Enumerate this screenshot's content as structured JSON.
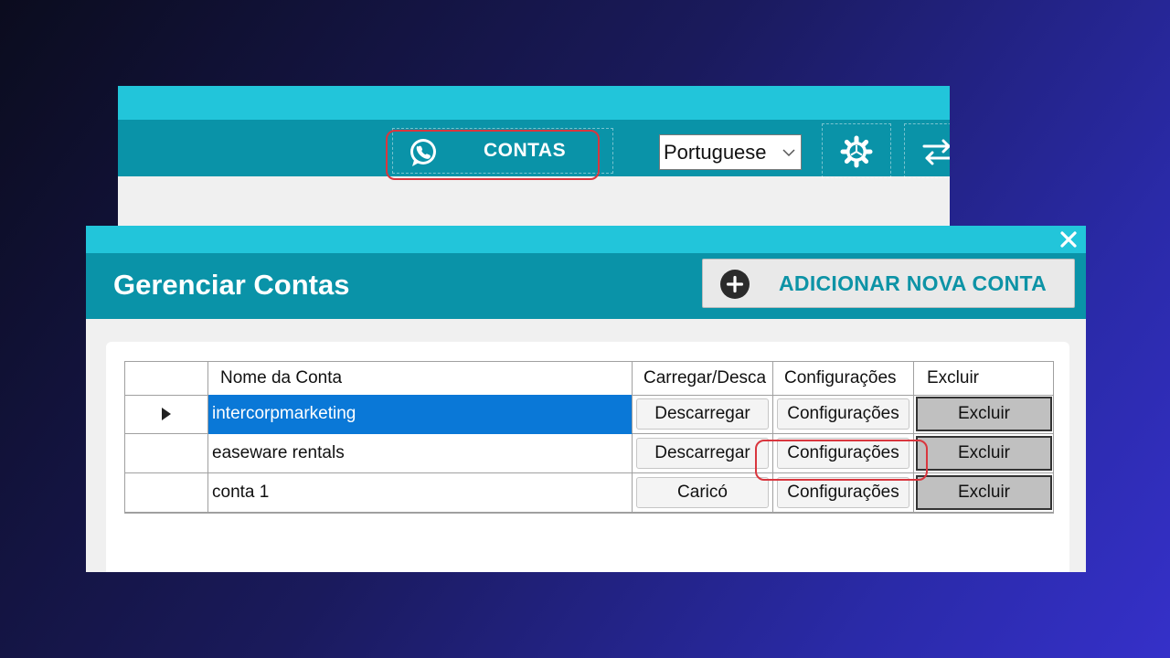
{
  "back_window": {
    "contas_label": "CONTAS",
    "language": {
      "selected": "Portuguese"
    }
  },
  "dialog": {
    "title": "Gerenciar Contas",
    "add_button_label": "ADICIONAR NOVA CONTA",
    "grid": {
      "columns": [
        "",
        "Nome da Conta",
        "Carregar/Desca",
        "Configurações",
        "Excluir"
      ],
      "rows": [
        {
          "name": "intercorpmarketing",
          "load": "Descarregar",
          "config": "Configurações",
          "delete": "Excluir",
          "current": true,
          "selected": true
        },
        {
          "name": "easeware rentals",
          "load": "Descarregar",
          "config": "Configurações",
          "delete": "Excluir",
          "current": false,
          "selected": false
        },
        {
          "name": "conta 1",
          "load": "Caricó",
          "config": "Configurações",
          "delete": "Excluir",
          "current": false,
          "selected": false
        }
      ]
    }
  },
  "colors": {
    "header_teal": "#0a93a8",
    "light_cyan": "#22c5da",
    "selection_blue": "#0a78d7",
    "highlight_red": "#d9363e",
    "add_label_teal": "#0d93a6"
  },
  "icons": {
    "contas": "whatsapp-icon",
    "settings": "gear-icon",
    "swap": "swap-arrows-icon",
    "close": "close-icon",
    "add": "plus-circle-icon",
    "dropdown": "chevron-down-icon",
    "row_pointer": "row-pointer-icon"
  }
}
